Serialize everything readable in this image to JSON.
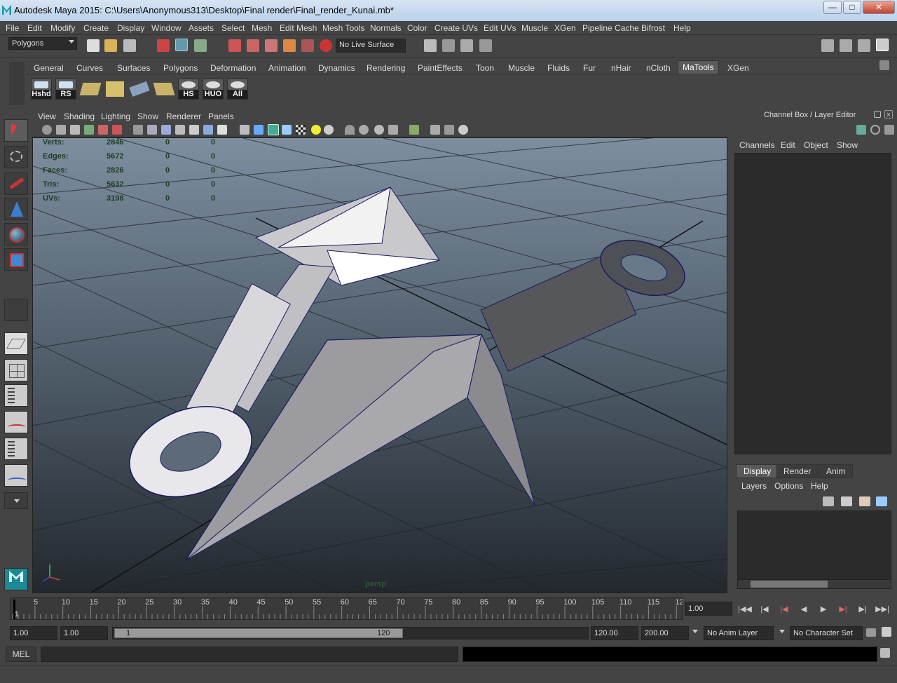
{
  "window": {
    "title": "Autodesk Maya 2015: C:\\Users\\Anonymous313\\Desktop\\Final render\\Final_render_Kunai.mb*",
    "minimize": "—",
    "maximize": "□",
    "close": "✕"
  },
  "menubar": [
    "File",
    "Edit",
    "Modify",
    "Create",
    "Display",
    "Window",
    "Assets",
    "Select",
    "Mesh",
    "Edit Mesh",
    "Mesh Tools",
    "Normals",
    "Color",
    "Create UVs",
    "Edit UVs",
    "Muscle",
    "XGen",
    "Pipeline Cache",
    "Bifrost",
    "Help"
  ],
  "statusline": {
    "mode": "Polygons",
    "live_surface": "No Live Surface"
  },
  "shelf": {
    "tabs": [
      "General",
      "Curves",
      "Surfaces",
      "Polygons",
      "Deformation",
      "Animation",
      "Dynamics",
      "Rendering",
      "PaintEffects",
      "Toon",
      "Muscle",
      "Fluids",
      "Fur",
      "nHair",
      "nCloth",
      "MaTools",
      "XGen"
    ],
    "active_tab": "MaTools",
    "buttons": [
      "Hshd",
      "RS",
      "",
      "",
      "",
      "",
      "HS",
      "HUO",
      "All"
    ]
  },
  "panel": {
    "menus": [
      "View",
      "Shading",
      "Lighting",
      "Show",
      "Renderer",
      "Panels"
    ],
    "camera": "persp"
  },
  "hud": [
    {
      "label": "Verts:",
      "v1": "2846",
      "v2": "0",
      "v3": "0"
    },
    {
      "label": "Edges:",
      "v1": "5672",
      "v2": "0",
      "v3": "0"
    },
    {
      "label": "Faces:",
      "v1": "2826",
      "v2": "0",
      "v3": "0"
    },
    {
      "label": "Tris:",
      "v1": "5632",
      "v2": "0",
      "v3": "0"
    },
    {
      "label": "UVs:",
      "v1": "3198",
      "v2": "0",
      "v3": "0"
    }
  ],
  "channelbox": {
    "title": "Channel Box / Layer Editor",
    "menus": [
      "Channels",
      "Edit",
      "Object",
      "Show"
    ]
  },
  "layereditor": {
    "tabs": [
      "Display",
      "Render",
      "Anim"
    ],
    "active_tab": "Display",
    "menus": [
      "Layers",
      "Options",
      "Help"
    ]
  },
  "timeline": {
    "ticks": [
      "5",
      "10",
      "15",
      "20",
      "25",
      "30",
      "35",
      "40",
      "45",
      "50",
      "55",
      "60",
      "65",
      "70",
      "75",
      "80",
      "85",
      "90",
      "95",
      "100",
      "105",
      "110",
      "115",
      "12"
    ],
    "current_frame_field": "1.00",
    "playhead_label": "1"
  },
  "rangebar": {
    "start_time": "1.00",
    "playback_start": "1.00",
    "slider_start": "1",
    "slider_end": "120",
    "playback_end": "120.00",
    "end_time": "200.00",
    "anim_layer": "No Anim Layer",
    "character_set": "No Character Set"
  },
  "cmdline": {
    "label": "MEL"
  }
}
